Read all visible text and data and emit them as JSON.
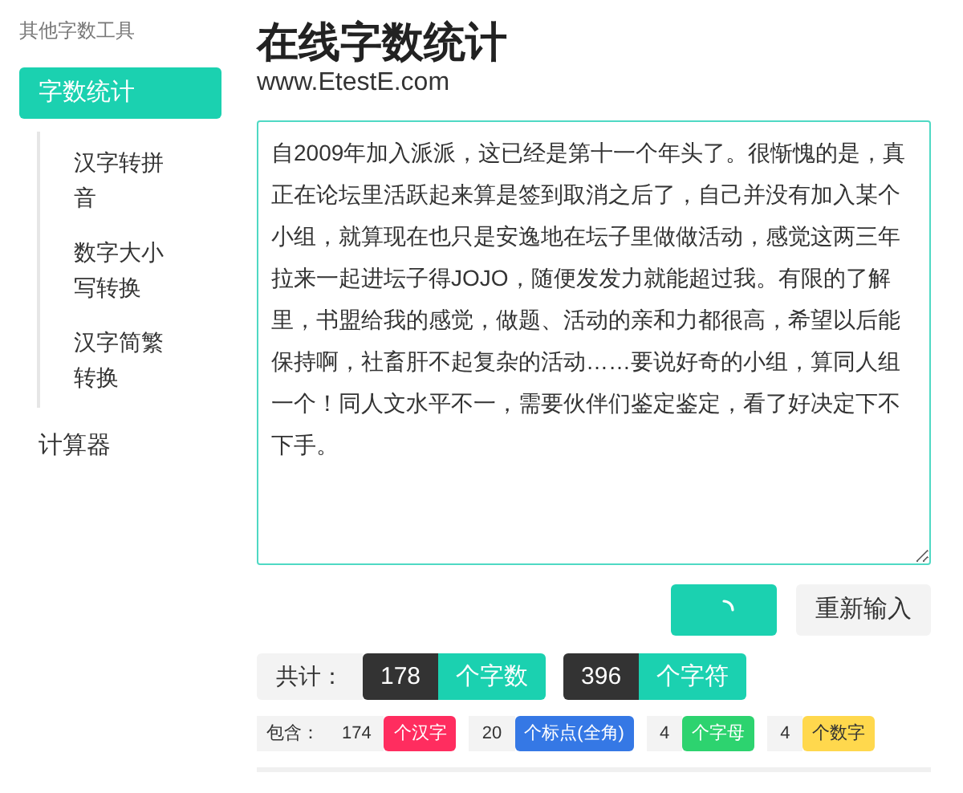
{
  "sidebar": {
    "heading": "其他字数工具",
    "items": [
      {
        "label": "字数统计",
        "selected": true,
        "children": [
          {
            "label": "汉字转拼音",
            "selected": false
          },
          {
            "label": "数字大小写转换",
            "selected": false
          },
          {
            "label": "汉字简繁转换",
            "selected": false
          }
        ]
      },
      {
        "label": "计算器",
        "selected": false
      }
    ]
  },
  "title": "在线字数统计",
  "site": "www.EtestE.com",
  "editor": {
    "value": "自2009年加入派派，这已经是第十一个年头了。很惭愧的是，真正在论坛里活跃起来算是签到取消之后了，自己并没有加入某个小组，就算现在也只是安逸地在坛子里做做活动，感觉这两三年拉来一起进坛子得JOJO，随便发发力就能超过我。有限的了解里，书盟给我的感觉，做题、活动的亲和力都很高，希望以后能保持啊，社畜肝不起复杂的活动……要说好奇的小组，算同人组一个！同人文水平不一，需要伙伴们鉴定鉴定，看了好决定下不下手。"
  },
  "buttons": [
    {
      "kind": "loading"
    },
    {
      "kind": "text",
      "label": "重新输入"
    }
  ],
  "totals": {
    "label": "共计：",
    "items": [
      {
        "value": "178",
        "unit": "个字数"
      },
      {
        "value": "396",
        "unit": "个字符"
      }
    ]
  },
  "breakdown": {
    "label": "包含：",
    "items": [
      {
        "value": "174",
        "unit": "个汉字",
        "color": "#ff2d5f"
      },
      {
        "value": "20",
        "unit": "个标点(全角)",
        "color": "#3578e5"
      },
      {
        "value": "4",
        "unit": "个字母",
        "color": "#2dd36f"
      },
      {
        "value": "4",
        "unit": "个数字",
        "color": "#ffd84d"
      }
    ]
  }
}
